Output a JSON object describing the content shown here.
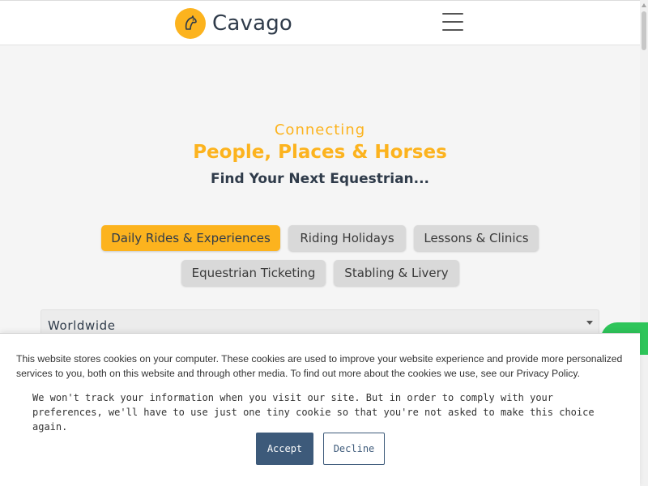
{
  "header": {
    "brand_name": "Cavago",
    "logo_icon": "horse-head-icon",
    "menu_icon": "hamburger-menu-icon"
  },
  "hero": {
    "kicker": "Connecting",
    "title": "People, Places & Horses",
    "subtitle": "Find Your Next Equestrian..."
  },
  "categories": [
    {
      "label": "Daily Rides & Experiences",
      "active": true
    },
    {
      "label": "Riding Holidays",
      "active": false
    },
    {
      "label": "Lessons & Clinics",
      "active": false
    },
    {
      "label": "Equestrian Ticketing",
      "active": false
    },
    {
      "label": "Stabling & Livery",
      "active": false
    }
  ],
  "search": {
    "location_value": "Worldwide"
  },
  "cookie_banner": {
    "notice": "This website stores cookies on your computer. These cookies are used to improve your website experience and provide more personalized services to you, both on this website and through other media. To find out more about the cookies we use, see our Privacy Policy.",
    "opt_out_notice": "We won't track your information when you visit our site. But in order to comply with your preferences, we'll have to use just one tiny cookie so that you're not asked to make this choice again.",
    "accept_label": "Accept",
    "decline_label": "Decline"
  },
  "colors": {
    "brand_accent": "#fcb31e",
    "heading_dark": "#2f3b4a",
    "button_primary": "#3d5a7a",
    "chat_green": "#2ec55a"
  }
}
